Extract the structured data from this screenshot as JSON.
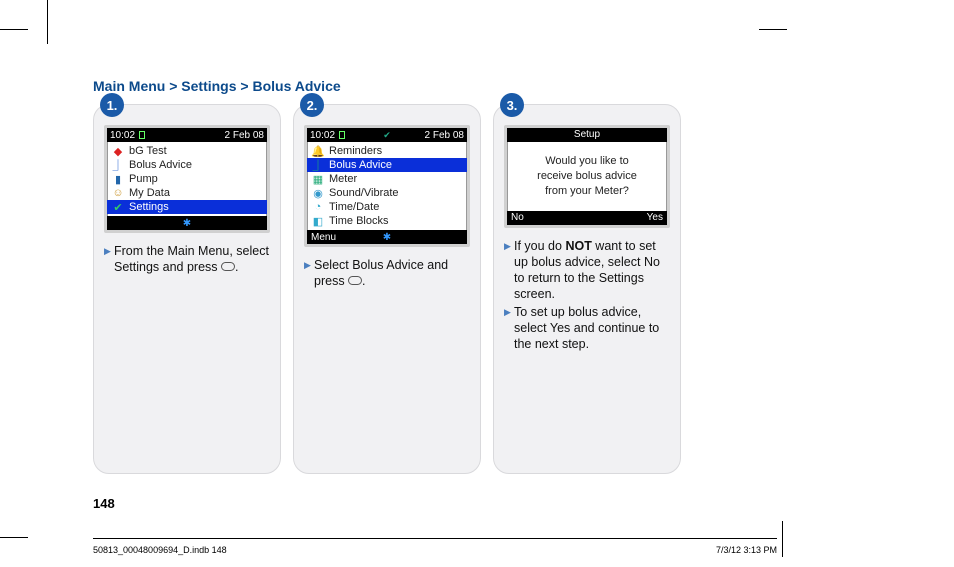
{
  "breadcrumb": "Main Menu > Settings > Bolus Advice",
  "steps": [
    {
      "marker": "1.",
      "status_time": "10:02",
      "status_date": "2 Feb 08",
      "menu": [
        "bG Test",
        "Bolus Advice",
        "Pump",
        "My Data",
        "Settings"
      ],
      "selected": "Settings",
      "icons": [
        "drop",
        "bolus",
        "pump",
        "mydata",
        "settings"
      ],
      "bottom_left": "",
      "bt": "✱",
      "instr": "From the Main Menu, select Settings and press "
    },
    {
      "marker": "2.",
      "status_time": "10:02",
      "status_date": "2 Feb 08",
      "menu": [
        "Reminders",
        "Bolus Advice",
        "Meter",
        "Sound/Vibrate",
        "Time/Date",
        "Time Blocks"
      ],
      "selected": "Bolus Advice",
      "icons": [
        "bell",
        "bolus",
        "meter",
        "sound",
        "clock",
        "blocks"
      ],
      "bottom_left": "Menu",
      "bt": "✱",
      "instr": "Select Bolus Advice and press "
    },
    {
      "marker": "3.",
      "setup_title": "Setup",
      "setup_body_l1": "Would you like to",
      "setup_body_l2": "receive bolus advice",
      "setup_body_l3": "from your Meter?",
      "soft_left": "No",
      "soft_right": "Yes",
      "instr1_a": "If you do ",
      "instr1_bold": "NOT",
      "instr1_b": " want to set up bolus advice, select No to return to the Settings screen.",
      "instr2": "To set up bolus advice, select Yes and continue to the next step."
    }
  ],
  "page_number": "148",
  "footer_left": "50813_00048009694_D.indb   148",
  "footer_right": "7/3/12   3:13 PM"
}
